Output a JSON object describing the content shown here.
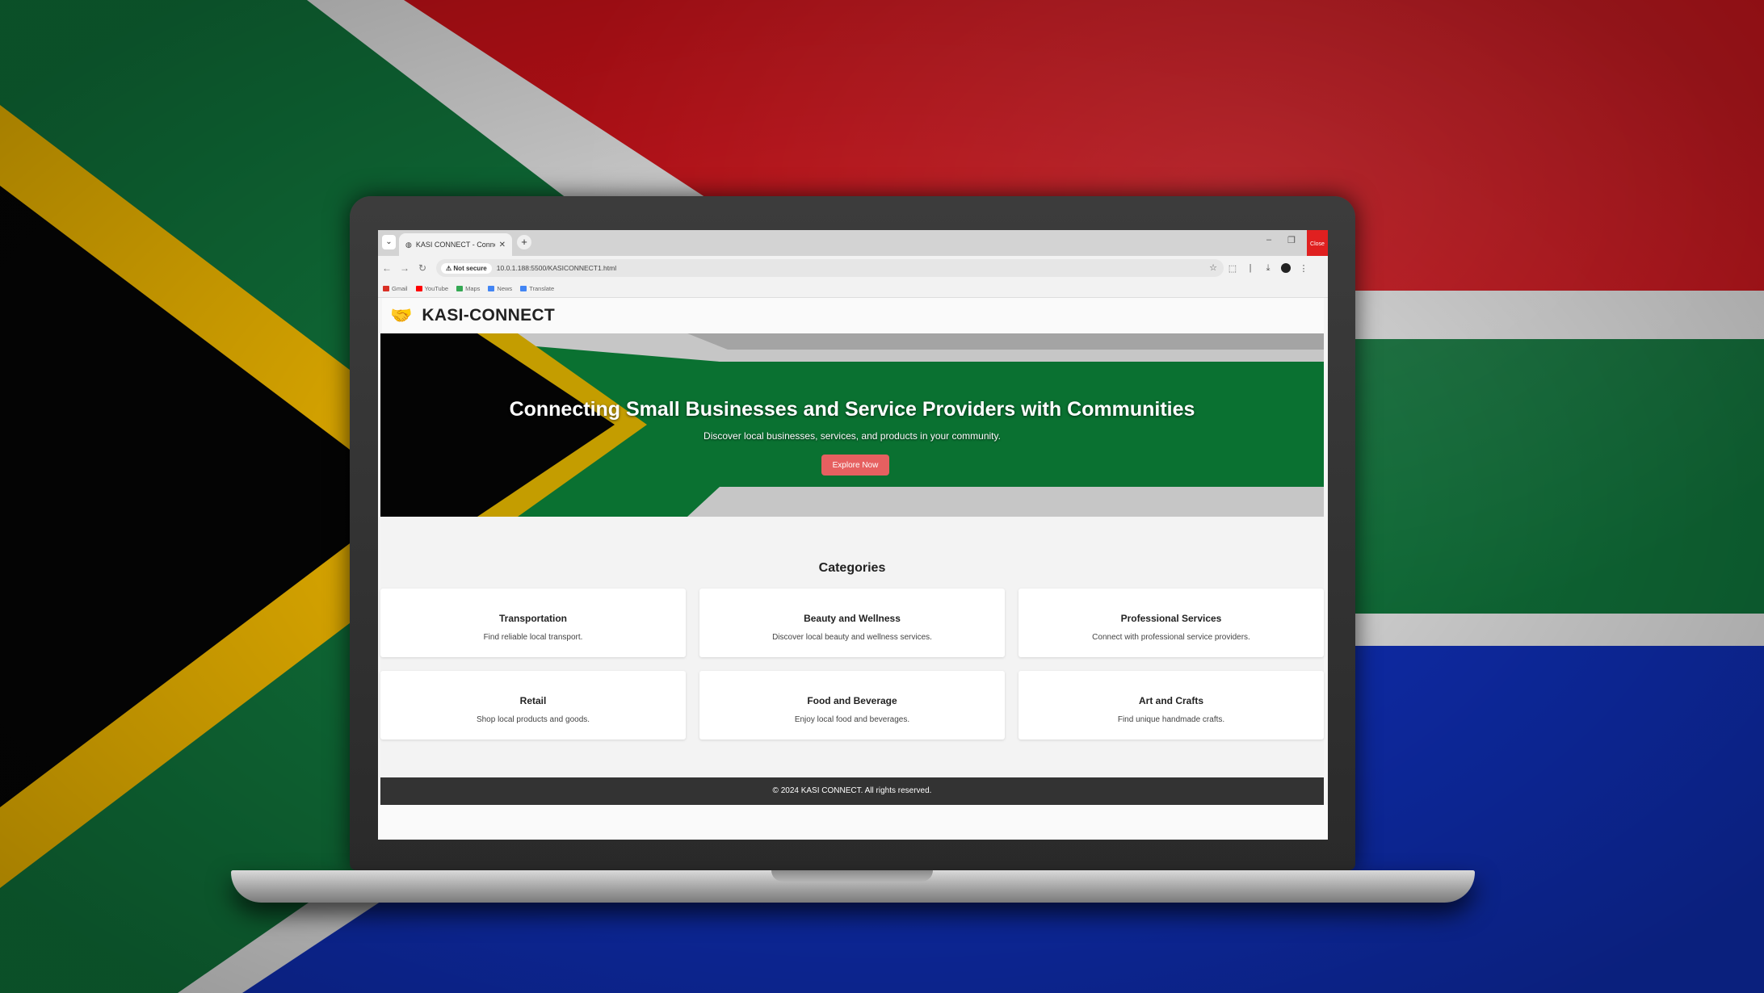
{
  "browser": {
    "tab_title": "KASI CONNECT - Connecting C",
    "close_tooltip": "Close",
    "address": {
      "security": "Not secure",
      "url": "10.0.1.188:5500/KASICONNECT1.html"
    },
    "bookmarks": [
      {
        "label": "Gmail",
        "icon": "gmail-icon",
        "color": "#d93025"
      },
      {
        "label": "YouTube",
        "icon": "youtube-icon",
        "color": "#ff0000"
      },
      {
        "label": "Maps",
        "icon": "maps-icon",
        "color": "#34a853"
      },
      {
        "label": "News",
        "icon": "news-icon",
        "color": "#4285f4"
      },
      {
        "label": "Translate",
        "icon": "translate-icon",
        "color": "#4285f4"
      }
    ]
  },
  "site": {
    "brand": "KASI-CONNECT",
    "hero": {
      "title": "Connecting Small Businesses and Service Providers with Communities",
      "subtitle": "Discover local businesses, services, and products in your community.",
      "cta": "Explore Now"
    },
    "categories_heading": "Categories",
    "categories": [
      {
        "title": "Transportation",
        "desc": "Find reliable local transport."
      },
      {
        "title": "Beauty and Wellness",
        "desc": "Discover local beauty and wellness services."
      },
      {
        "title": "Professional Services",
        "desc": "Connect with professional service providers."
      },
      {
        "title": "Retail",
        "desc": "Shop local products and goods."
      },
      {
        "title": "Food and Beverage",
        "desc": "Enjoy local food and beverages."
      },
      {
        "title": "Art and Crafts",
        "desc": "Find unique handmade crafts."
      }
    ],
    "footer": "© 2024 KASI CONNECT. All rights reserved."
  },
  "colors": {
    "flag_green": "#007a4d",
    "flag_red": "#de1a1a",
    "flag_blue": "#1034c8",
    "flag_gold": "#ffc300",
    "cta": "#e66060",
    "footer": "#333333"
  }
}
